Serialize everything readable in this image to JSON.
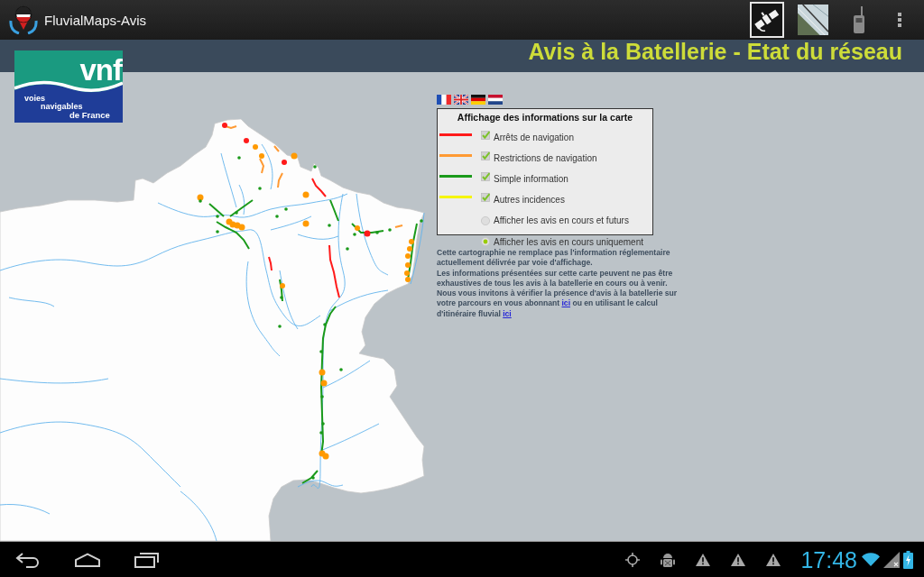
{
  "app_bar": {
    "title": "FluvialMaps-Avis",
    "actions": [
      {
        "kind": "satellite",
        "selected": true
      },
      {
        "kind": "map",
        "selected": false
      },
      {
        "kind": "handheld",
        "selected": false
      }
    ]
  },
  "header": {
    "title": "Avis à la Batellerie - Etat du réseau"
  },
  "logo": {
    "wordmark": "vnf",
    "tagline": [
      "voies",
      "navigables",
      "de France"
    ]
  },
  "languages": [
    {
      "kind": "fr"
    },
    {
      "kind": "en"
    },
    {
      "kind": "de"
    },
    {
      "kind": "nl"
    }
  ],
  "legend": {
    "title": "Affichage des informations sur la carte",
    "layers": [
      {
        "label": "Arrêts de navigation",
        "color": "#ff1a1a",
        "checked": true
      },
      {
        "label": "Restrictions de navigation",
        "color": "#ff9a33",
        "checked": true
      },
      {
        "label": "Simple information",
        "color": "#1a9a1a",
        "checked": true
      },
      {
        "label": "Autres incidences",
        "color": "#f5f500",
        "checked": true
      }
    ],
    "filters": [
      {
        "label": "Afficher les avis en cours et futurs",
        "selected": false
      },
      {
        "label": "Afficher les avis en cours uniquement",
        "selected": true
      }
    ]
  },
  "notice": [
    {
      "parts": [
        {
          "kind": "text",
          "text": "Cette cartographie ne remplace pas l'information réglementaire actuellement délivrée par voie d'affichage."
        }
      ]
    },
    {
      "parts": [
        {
          "kind": "text",
          "text": "Les informations présentées sur cette carte peuvent ne pas être exhaustives de tous les avis à la batellerie en cours ou à venir."
        }
      ]
    },
    {
      "parts": [
        {
          "kind": "text",
          "text": "Nous vous invitons à vérifier la présence d'avis à la batellerie sur votre parcours en vous abonnant "
        },
        {
          "kind": "link",
          "text": "ici"
        },
        {
          "kind": "text",
          "text": " ou en utilisant le calcul d'itinéraire fluvial "
        },
        {
          "kind": "link",
          "text": "ici"
        }
      ]
    }
  ],
  "status_bar": {
    "time": "17:48",
    "notifications": [
      {
        "kind": "gps"
      },
      {
        "kind": "debug"
      },
      {
        "kind": "warning"
      },
      {
        "kind": "warning"
      },
      {
        "kind": "warning"
      }
    ]
  }
}
